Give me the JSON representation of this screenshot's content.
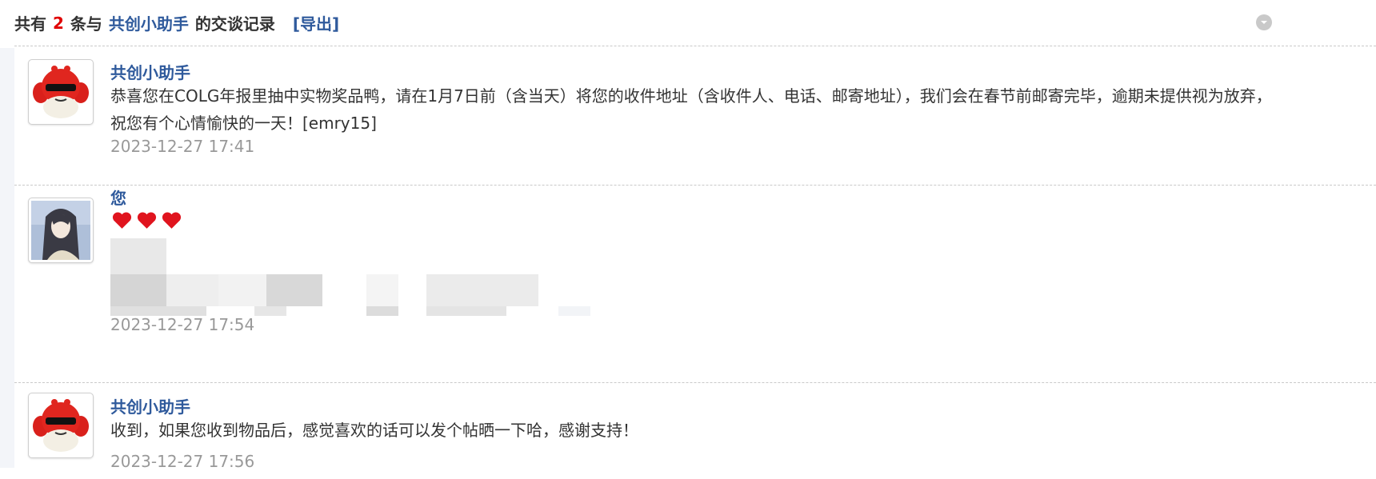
{
  "header": {
    "prefix": "共有",
    "count": "2",
    "middle": "条与",
    "peer_name": "共创小助手",
    "suffix": "的交谈记录",
    "export_label": "[导出]"
  },
  "messages": [
    {
      "author": "共创小助手",
      "text": "恭喜您在COLG年报里抽中实物奖品鸭，请在1月7日前（含当天）将您的收件地址（含收件人、电话、邮寄地址），我们会在春节前邮寄完毕，逾期未提供视为放弃，祝您有个心情愉快的一天！[emry15]",
      "time": "2023-12-27 17:41"
    },
    {
      "author": "您",
      "hearts": 3,
      "time": "2023-12-27 17:54"
    },
    {
      "author": "共创小助手",
      "text": "收到，如果您收到物品后，感觉喜欢的话可以发个帖晒一下哈，感谢支持！",
      "time": "2023-12-27 17:56"
    }
  ],
  "icons": {
    "collapse": "chevron-down-icon",
    "heart": "heart-icon"
  },
  "colors": {
    "link": "#2f5a9c",
    "count": "#e00000",
    "timestamp": "#999999",
    "heart": "#e0141e"
  }
}
